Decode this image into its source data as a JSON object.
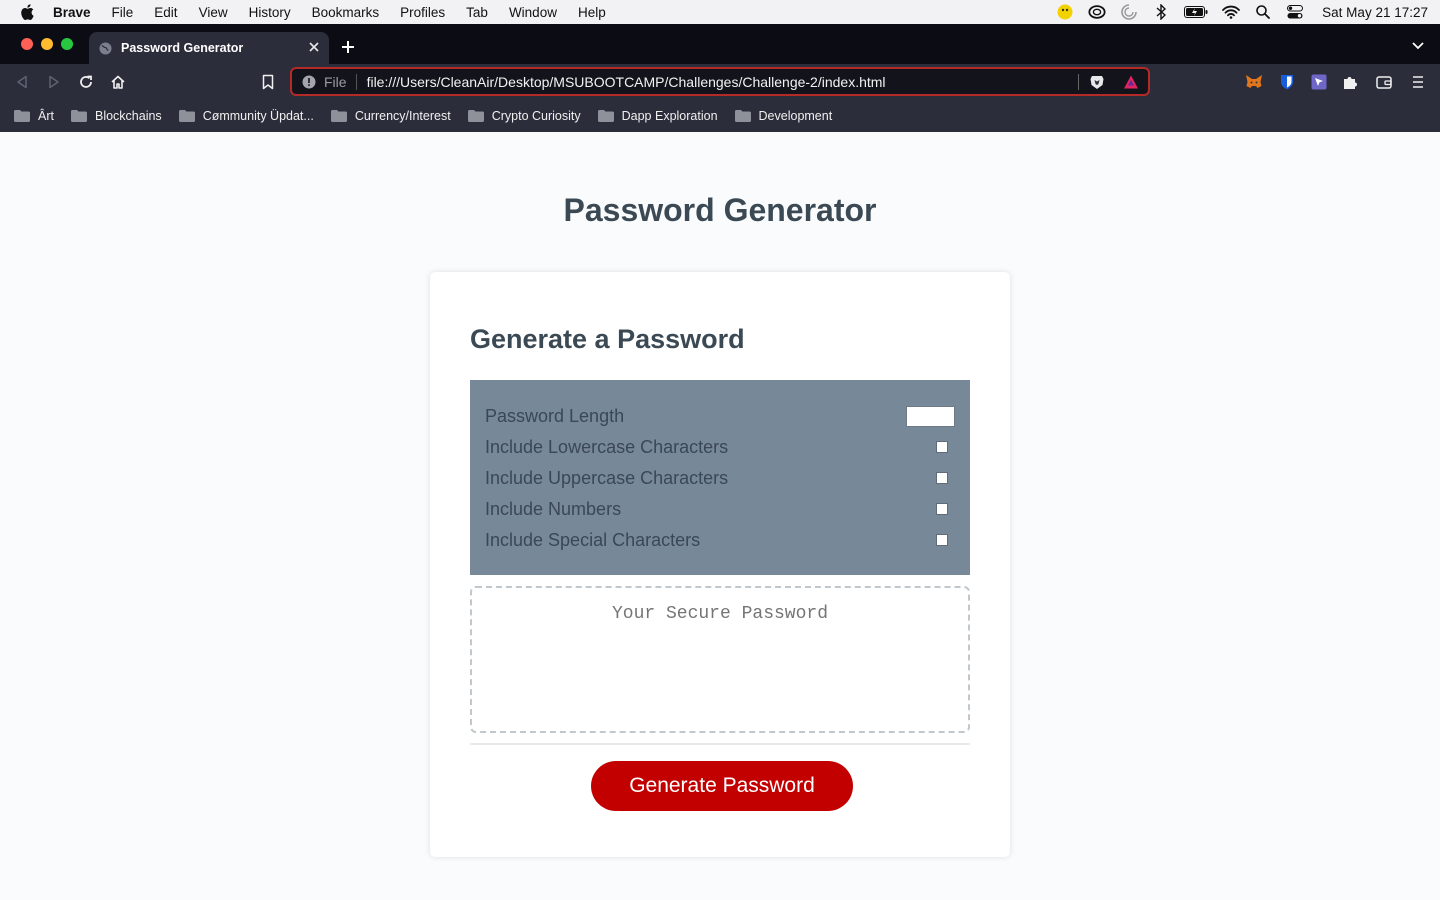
{
  "menubar": {
    "app": "Brave",
    "items": [
      "File",
      "Edit",
      "View",
      "History",
      "Bookmarks",
      "Profiles",
      "Tab",
      "Window",
      "Help"
    ],
    "clock": "Sat May 21  17:27"
  },
  "browser": {
    "tab_title": "Password Generator",
    "url_scheme": "File",
    "url": "file:///Users/CleanAir/Desktop/MSUBOOTCAMP/Challenges/Challenge-2/index.html",
    "bookmarks": [
      "Ârt",
      "Blockchains",
      "Cømmunity Üpdat...",
      "Currency/Interest",
      "Crypto Curiosity",
      "Dapp Exploration",
      "Development"
    ]
  },
  "page": {
    "title": "Password Generator",
    "card_header": "Generate a Password",
    "criteria": {
      "length_label": "Password Length",
      "length_value": "",
      "lowercase_label": "Include Lowercase Characters",
      "uppercase_label": "Include Uppercase Characters",
      "numbers_label": "Include Numbers",
      "special_label": "Include Special Characters"
    },
    "password_placeholder": "Your Secure Password",
    "generate_button": "Generate Password"
  },
  "colors": {
    "heading": "#3b4a58",
    "criteria_bg": "#778899",
    "button": "#c20000",
    "url_border": "#b32a26"
  }
}
